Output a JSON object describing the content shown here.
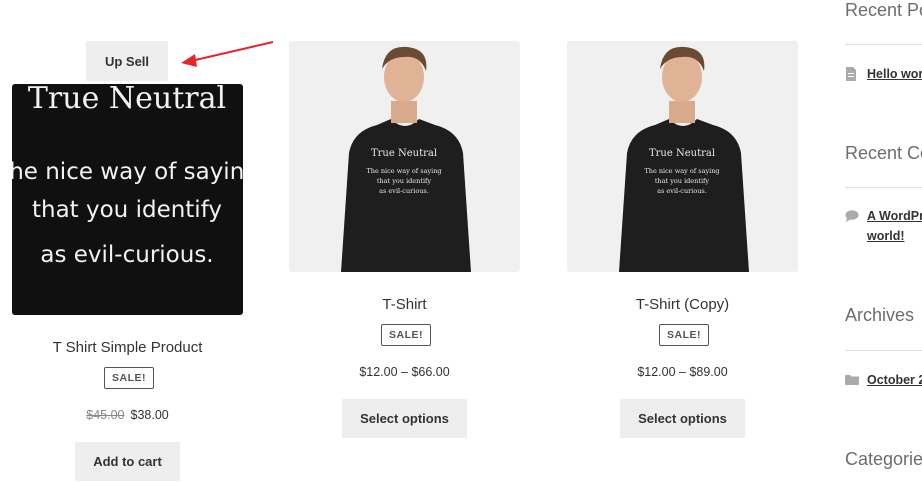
{
  "upsell_label": "Up Sell",
  "products": [
    {
      "title": "T Shirt Simple Product",
      "badge": "SALE!",
      "old_price": "$45.00",
      "price": "$38.00",
      "button": "Add to cart",
      "image_text": [
        "True Neutral",
        "The nice way of saying",
        "that you identify",
        "as evil-curious."
      ]
    },
    {
      "title": "T-Shirt",
      "badge": "SALE!",
      "price": "$12.00 – $66.00",
      "button": "Select options",
      "image_text": [
        "True Neutral",
        "The nice way of saying",
        "that you identify",
        "as evil-curious."
      ]
    },
    {
      "title": "T-Shirt (Copy)",
      "badge": "SALE!",
      "price": "$12.00 – $89.00",
      "button": "Select options",
      "image_text": [
        "True Neutral",
        "The nice way of saying",
        "that you identify",
        "as evil-curious."
      ]
    }
  ],
  "sidebar": {
    "recent_posts_heading": "Recent Po",
    "recent_post_link": "Hello wor",
    "recent_comments_heading": "Recent Co",
    "recent_comment_link_1": "A WordPr",
    "recent_comment_link_2": "world!",
    "archives_heading": "Archives",
    "archive_link": "October 2",
    "categories_heading": "Categorie"
  },
  "colors": {
    "arrow": "#e5262b",
    "button_bg": "#eeeeee",
    "image_bg": "#f0f0f0",
    "shirt": "#1e1e1e"
  }
}
